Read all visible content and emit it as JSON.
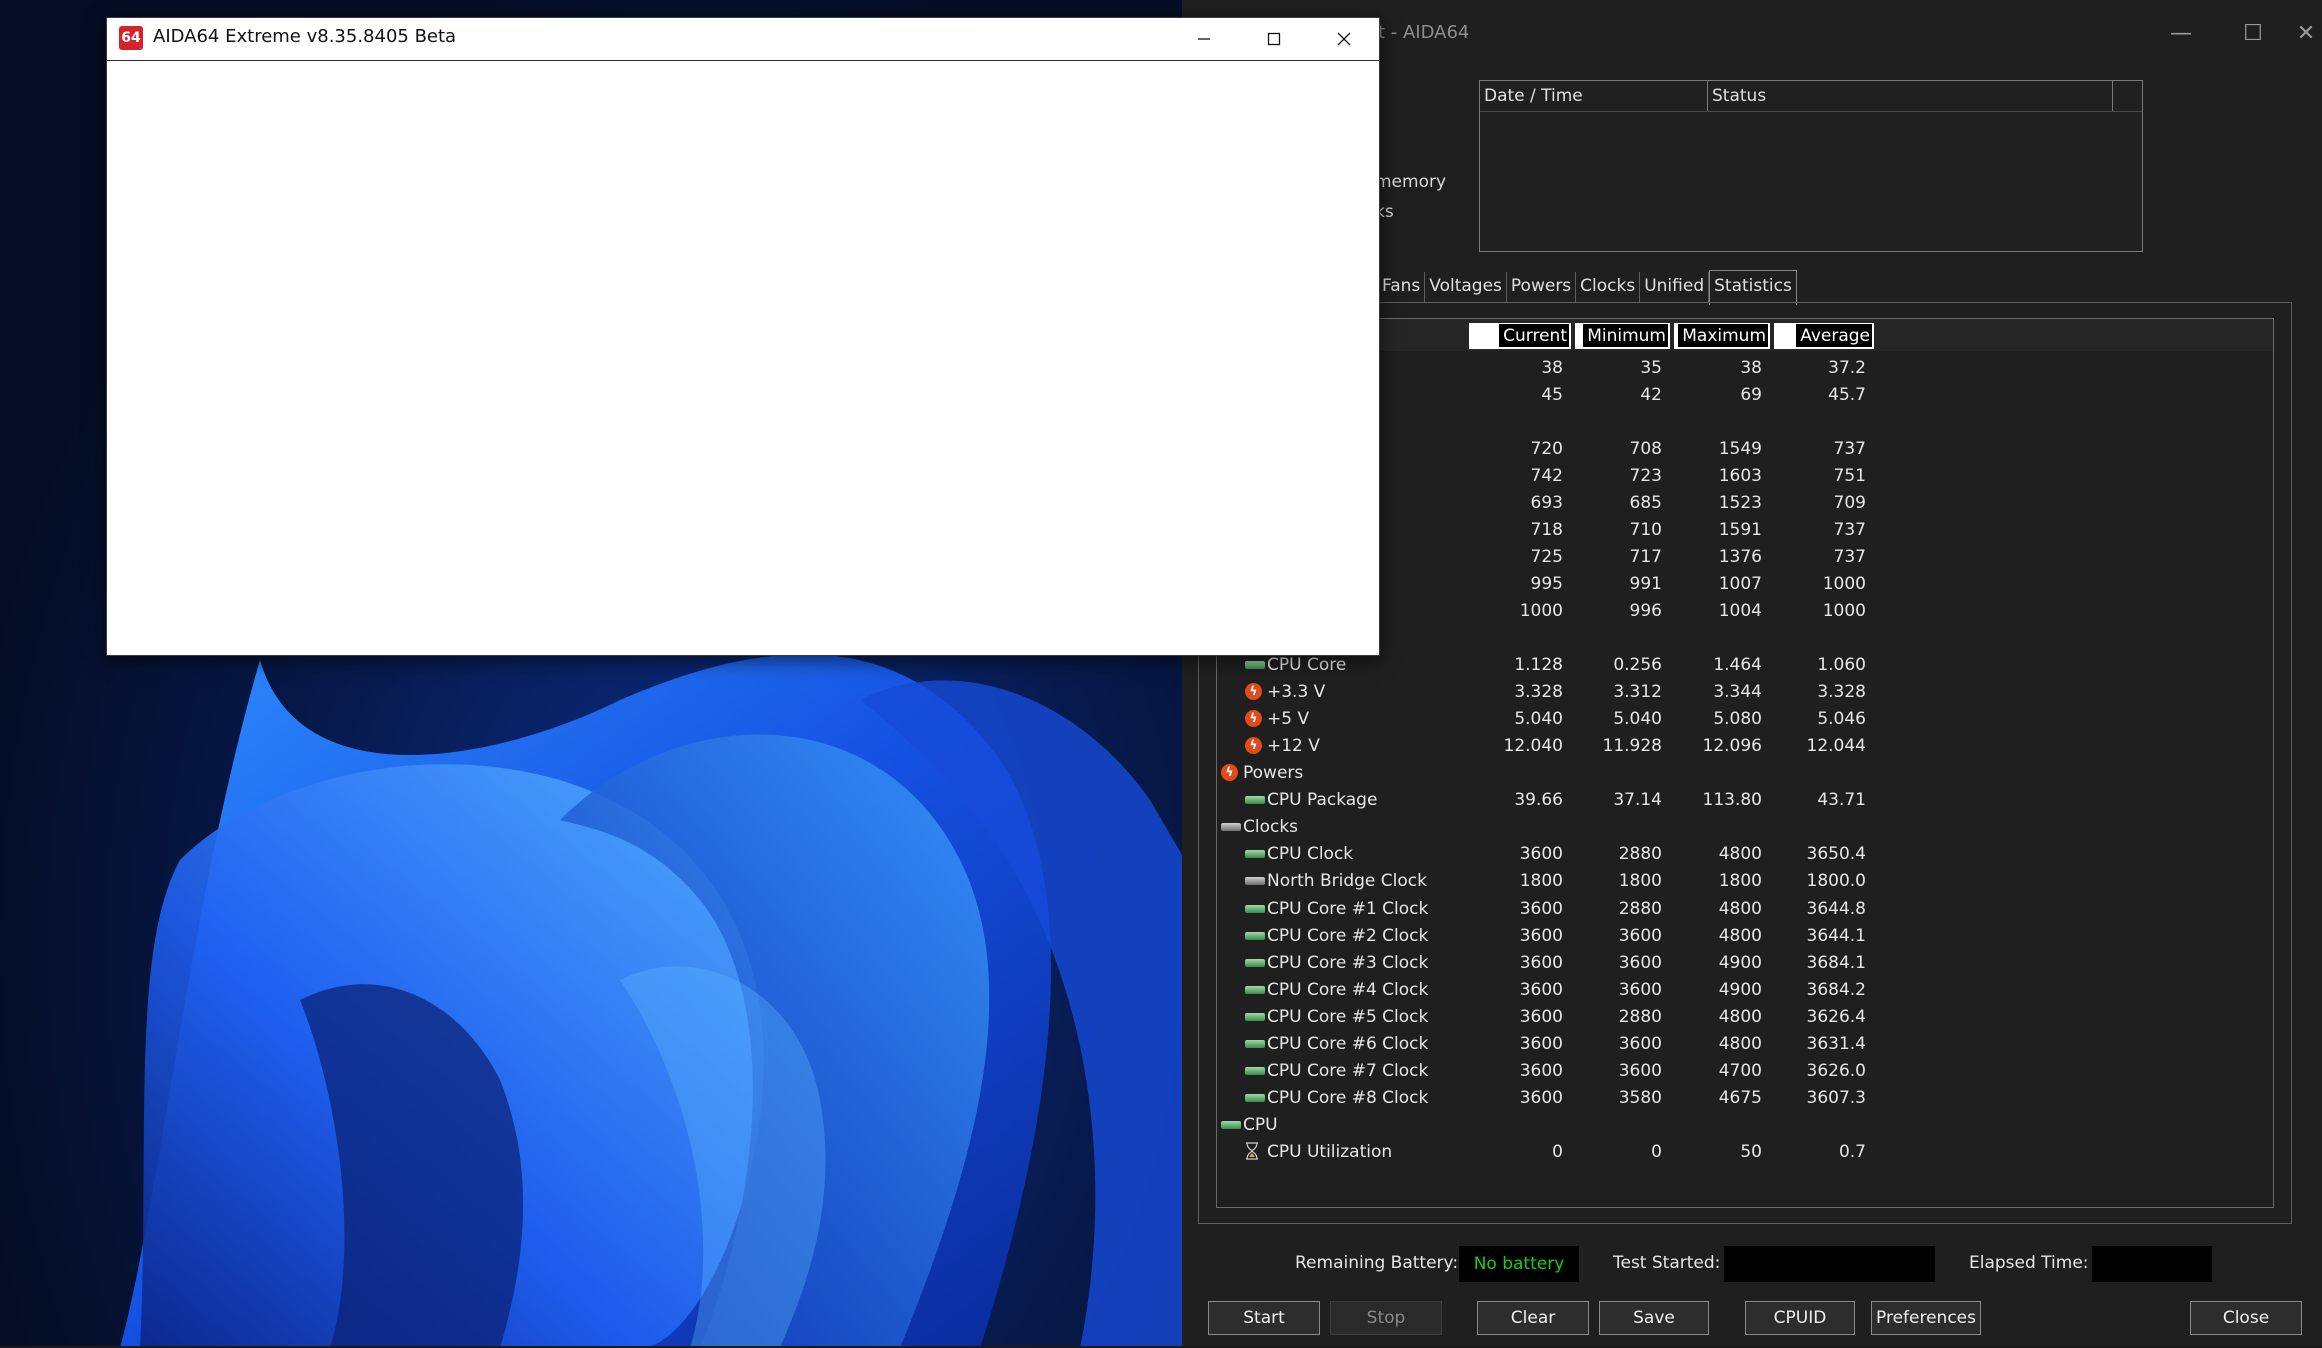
{
  "aida_window": {
    "logo": "64",
    "title": "AIDA64 Extreme v8.35.8405 Beta",
    "minimize_icon": "minimize-icon",
    "maximize_icon": "maximize-icon",
    "close_icon": "close-icon"
  },
  "stability_window": {
    "title_fragment": "t - AIDA64",
    "tree_fragments": [
      "memory",
      "ks"
    ],
    "status_table": {
      "headers": [
        "Date / Time",
        "Status"
      ]
    },
    "tabs": [
      {
        "label": "Fans"
      },
      {
        "label": "Voltages"
      },
      {
        "label": "Powers"
      },
      {
        "label": "Clocks"
      },
      {
        "label": "Unified"
      },
      {
        "label": "Statistics",
        "active": true
      }
    ],
    "stats_columns": [
      "Current",
      "Minimum",
      "Maximum",
      "Average"
    ],
    "stats_rows": [
      {
        "kind": "item",
        "label": "",
        "icon": "",
        "values": [
          "38",
          "35",
          "38",
          "37.2"
        ]
      },
      {
        "kind": "item",
        "label": "",
        "icon": "",
        "values": [
          "45",
          "42",
          "69",
          "45.7"
        ]
      },
      {
        "kind": "blank"
      },
      {
        "kind": "item",
        "label": "",
        "icon": "",
        "values": [
          "720",
          "708",
          "1549",
          "737"
        ]
      },
      {
        "kind": "item",
        "label": "",
        "icon": "",
        "values": [
          "742",
          "723",
          "1603",
          "751"
        ]
      },
      {
        "kind": "item",
        "label": "",
        "icon": "",
        "values": [
          "693",
          "685",
          "1523",
          "709"
        ]
      },
      {
        "kind": "item",
        "label": "",
        "icon": "",
        "values": [
          "718",
          "710",
          "1591",
          "737"
        ]
      },
      {
        "kind": "item",
        "label": "",
        "icon": "",
        "values": [
          "725",
          "717",
          "1376",
          "737"
        ]
      },
      {
        "kind": "item",
        "label": "",
        "icon": "",
        "values": [
          "995",
          "991",
          "1007",
          "1000"
        ]
      },
      {
        "kind": "item",
        "label": "",
        "icon": "",
        "values": [
          "1000",
          "996",
          "1004",
          "1000"
        ]
      },
      {
        "kind": "group",
        "label": "Voltages",
        "icon": "voltage-icon"
      },
      {
        "kind": "item",
        "label": "CPU Core",
        "icon": "chip-icon",
        "values": [
          "1.128",
          "0.256",
          "1.464",
          "1.060"
        ]
      },
      {
        "kind": "item",
        "label": "+3.3 V",
        "icon": "voltage-icon",
        "values": [
          "3.328",
          "3.312",
          "3.344",
          "3.328"
        ]
      },
      {
        "kind": "item",
        "label": "+5 V",
        "icon": "voltage-icon",
        "values": [
          "5.040",
          "5.040",
          "5.080",
          "5.046"
        ]
      },
      {
        "kind": "item",
        "label": "+12 V",
        "icon": "voltage-icon",
        "values": [
          "12.040",
          "11.928",
          "12.096",
          "12.044"
        ]
      },
      {
        "kind": "group",
        "label": "Powers",
        "icon": "power-icon"
      },
      {
        "kind": "item",
        "label": "CPU Package",
        "icon": "chip-icon",
        "values": [
          "39.66",
          "37.14",
          "113.80",
          "43.71"
        ]
      },
      {
        "kind": "group",
        "label": "Clocks",
        "icon": "clock-chip-icon"
      },
      {
        "kind": "item",
        "label": "CPU Clock",
        "icon": "chip-icon",
        "values": [
          "3600",
          "2880",
          "4800",
          "3650.4"
        ]
      },
      {
        "kind": "item",
        "label": "North Bridge Clock",
        "icon": "northbridge-icon",
        "values": [
          "1800",
          "1800",
          "1800",
          "1800.0"
        ]
      },
      {
        "kind": "item",
        "label": "CPU Core #1 Clock",
        "icon": "chip-icon",
        "values": [
          "3600",
          "2880",
          "4800",
          "3644.8"
        ]
      },
      {
        "kind": "item",
        "label": "CPU Core #2 Clock",
        "icon": "chip-icon",
        "values": [
          "3600",
          "3600",
          "4800",
          "3644.1"
        ]
      },
      {
        "kind": "item",
        "label": "CPU Core #3 Clock",
        "icon": "chip-icon",
        "values": [
          "3600",
          "3600",
          "4900",
          "3684.1"
        ]
      },
      {
        "kind": "item",
        "label": "CPU Core #4 Clock",
        "icon": "chip-icon",
        "values": [
          "3600",
          "3600",
          "4900",
          "3684.2"
        ]
      },
      {
        "kind": "item",
        "label": "CPU Core #5 Clock",
        "icon": "chip-icon",
        "values": [
          "3600",
          "2880",
          "4800",
          "3626.4"
        ]
      },
      {
        "kind": "item",
        "label": "CPU Core #6 Clock",
        "icon": "chip-icon",
        "values": [
          "3600",
          "3600",
          "4800",
          "3631.4"
        ]
      },
      {
        "kind": "item",
        "label": "CPU Core #7 Clock",
        "icon": "chip-icon",
        "values": [
          "3600",
          "3600",
          "4700",
          "3626.0"
        ]
      },
      {
        "kind": "item",
        "label": "CPU Core #8 Clock",
        "icon": "chip-icon",
        "values": [
          "3600",
          "3580",
          "4675",
          "3607.3"
        ]
      },
      {
        "kind": "group",
        "label": "CPU",
        "icon": "chip-icon"
      },
      {
        "kind": "item",
        "label": "CPU Utilization",
        "icon": "hourglass-icon",
        "values": [
          "0",
          "0",
          "50",
          "0.7"
        ]
      }
    ],
    "info": {
      "battery_label": "Remaining Battery:",
      "battery_value": "No battery",
      "test_started_label": "Test Started:",
      "test_started_value": "",
      "elapsed_label": "Elapsed Time:",
      "elapsed_value": ""
    },
    "buttons": {
      "start": "Start",
      "stop": "Stop",
      "clear": "Clear",
      "save": "Save",
      "cpuid": "CPUID",
      "preferences": "Preferences",
      "close": "Close"
    }
  },
  "colors": {
    "accent_green": "#16d016",
    "aida_red": "#d4242b",
    "dark_bg": "#1f1f1f"
  }
}
